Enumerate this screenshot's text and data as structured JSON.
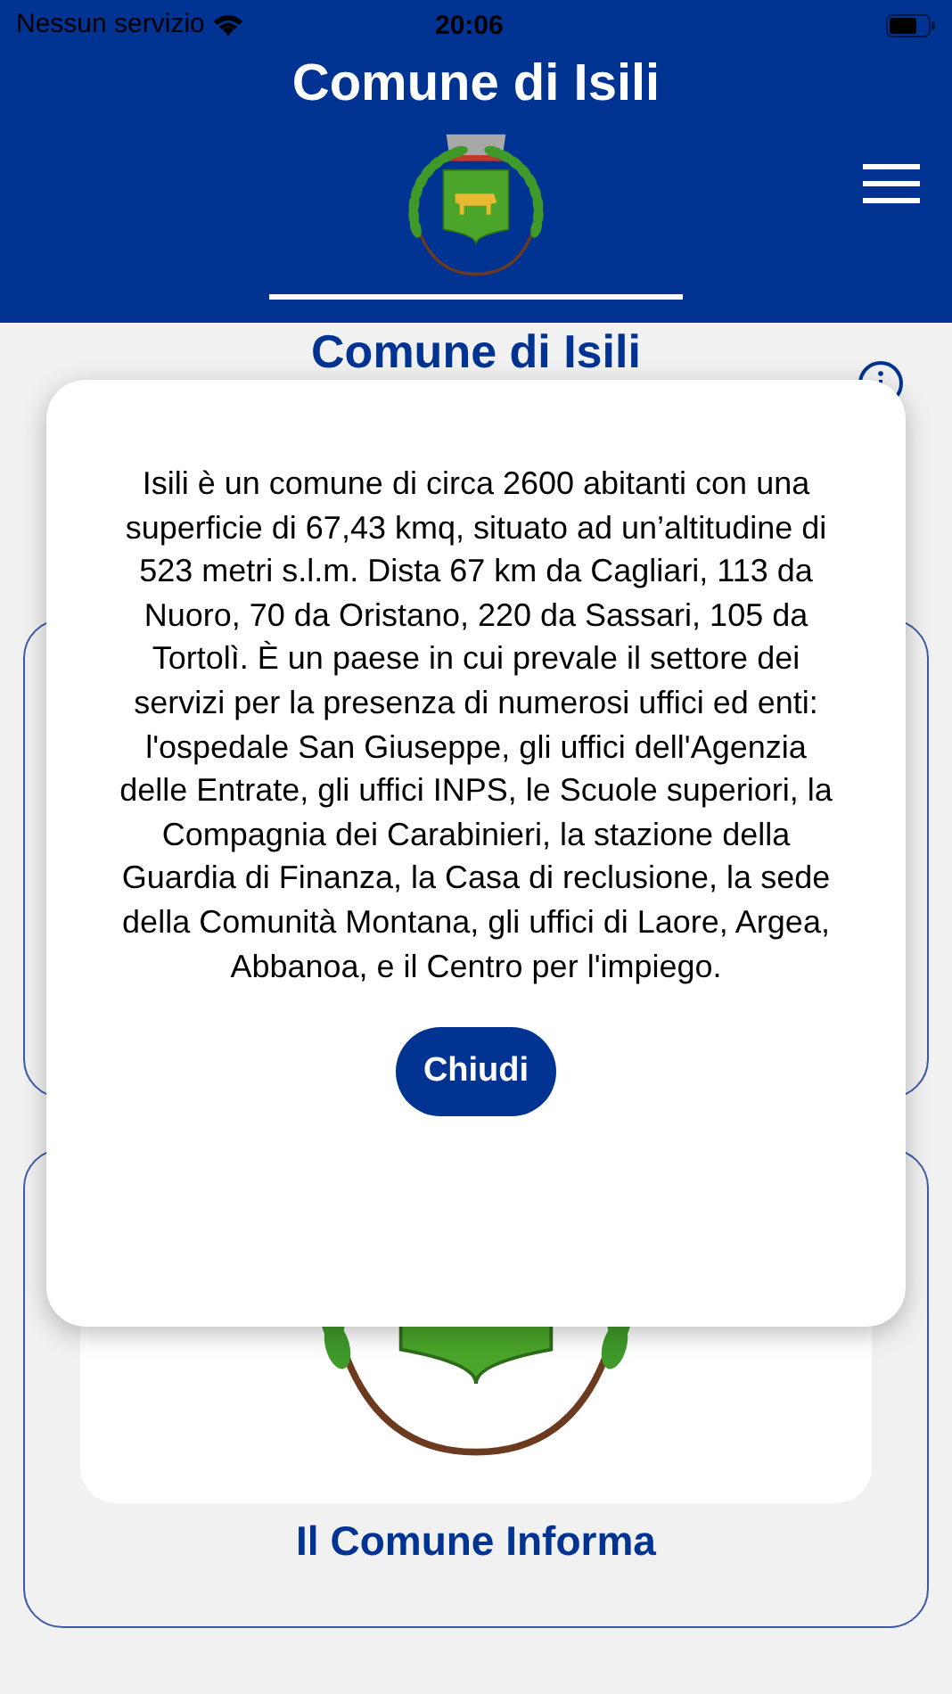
{
  "status_bar": {
    "carrier": "Nessun servizio",
    "time": "20:06"
  },
  "header": {
    "title": "Comune di Isili"
  },
  "page": {
    "heading": "Comune di Isili",
    "bottom_card": {
      "title": "Il Comune Informa"
    }
  },
  "dialog": {
    "text": "Isili è un comune di circa 2600 abitanti con una superficie di 67,43 kmq, situato ad un’altitudine di 523 metri s.l.m. Dista 67 km da Cagliari, 113 da Nuoro, 70 da Oristano, 220 da Sassari, 105 da Tortolì. È un paese in cui prevale il settore dei servizi per la presenza di  numerosi uffici ed enti: l'ospedale San Giuseppe, gli uffici dell'Agenzia delle Entrate, gli uffici INPS, le Scuole superiori, la Compagnia dei Carabinieri, la stazione della Guardia di Finanza, la Casa di reclusione, la sede della Comunità Montana, gli uffici di Laore, Argea, Abbanoa, e il Centro per l'impiego.",
    "button": "Chiudi"
  }
}
